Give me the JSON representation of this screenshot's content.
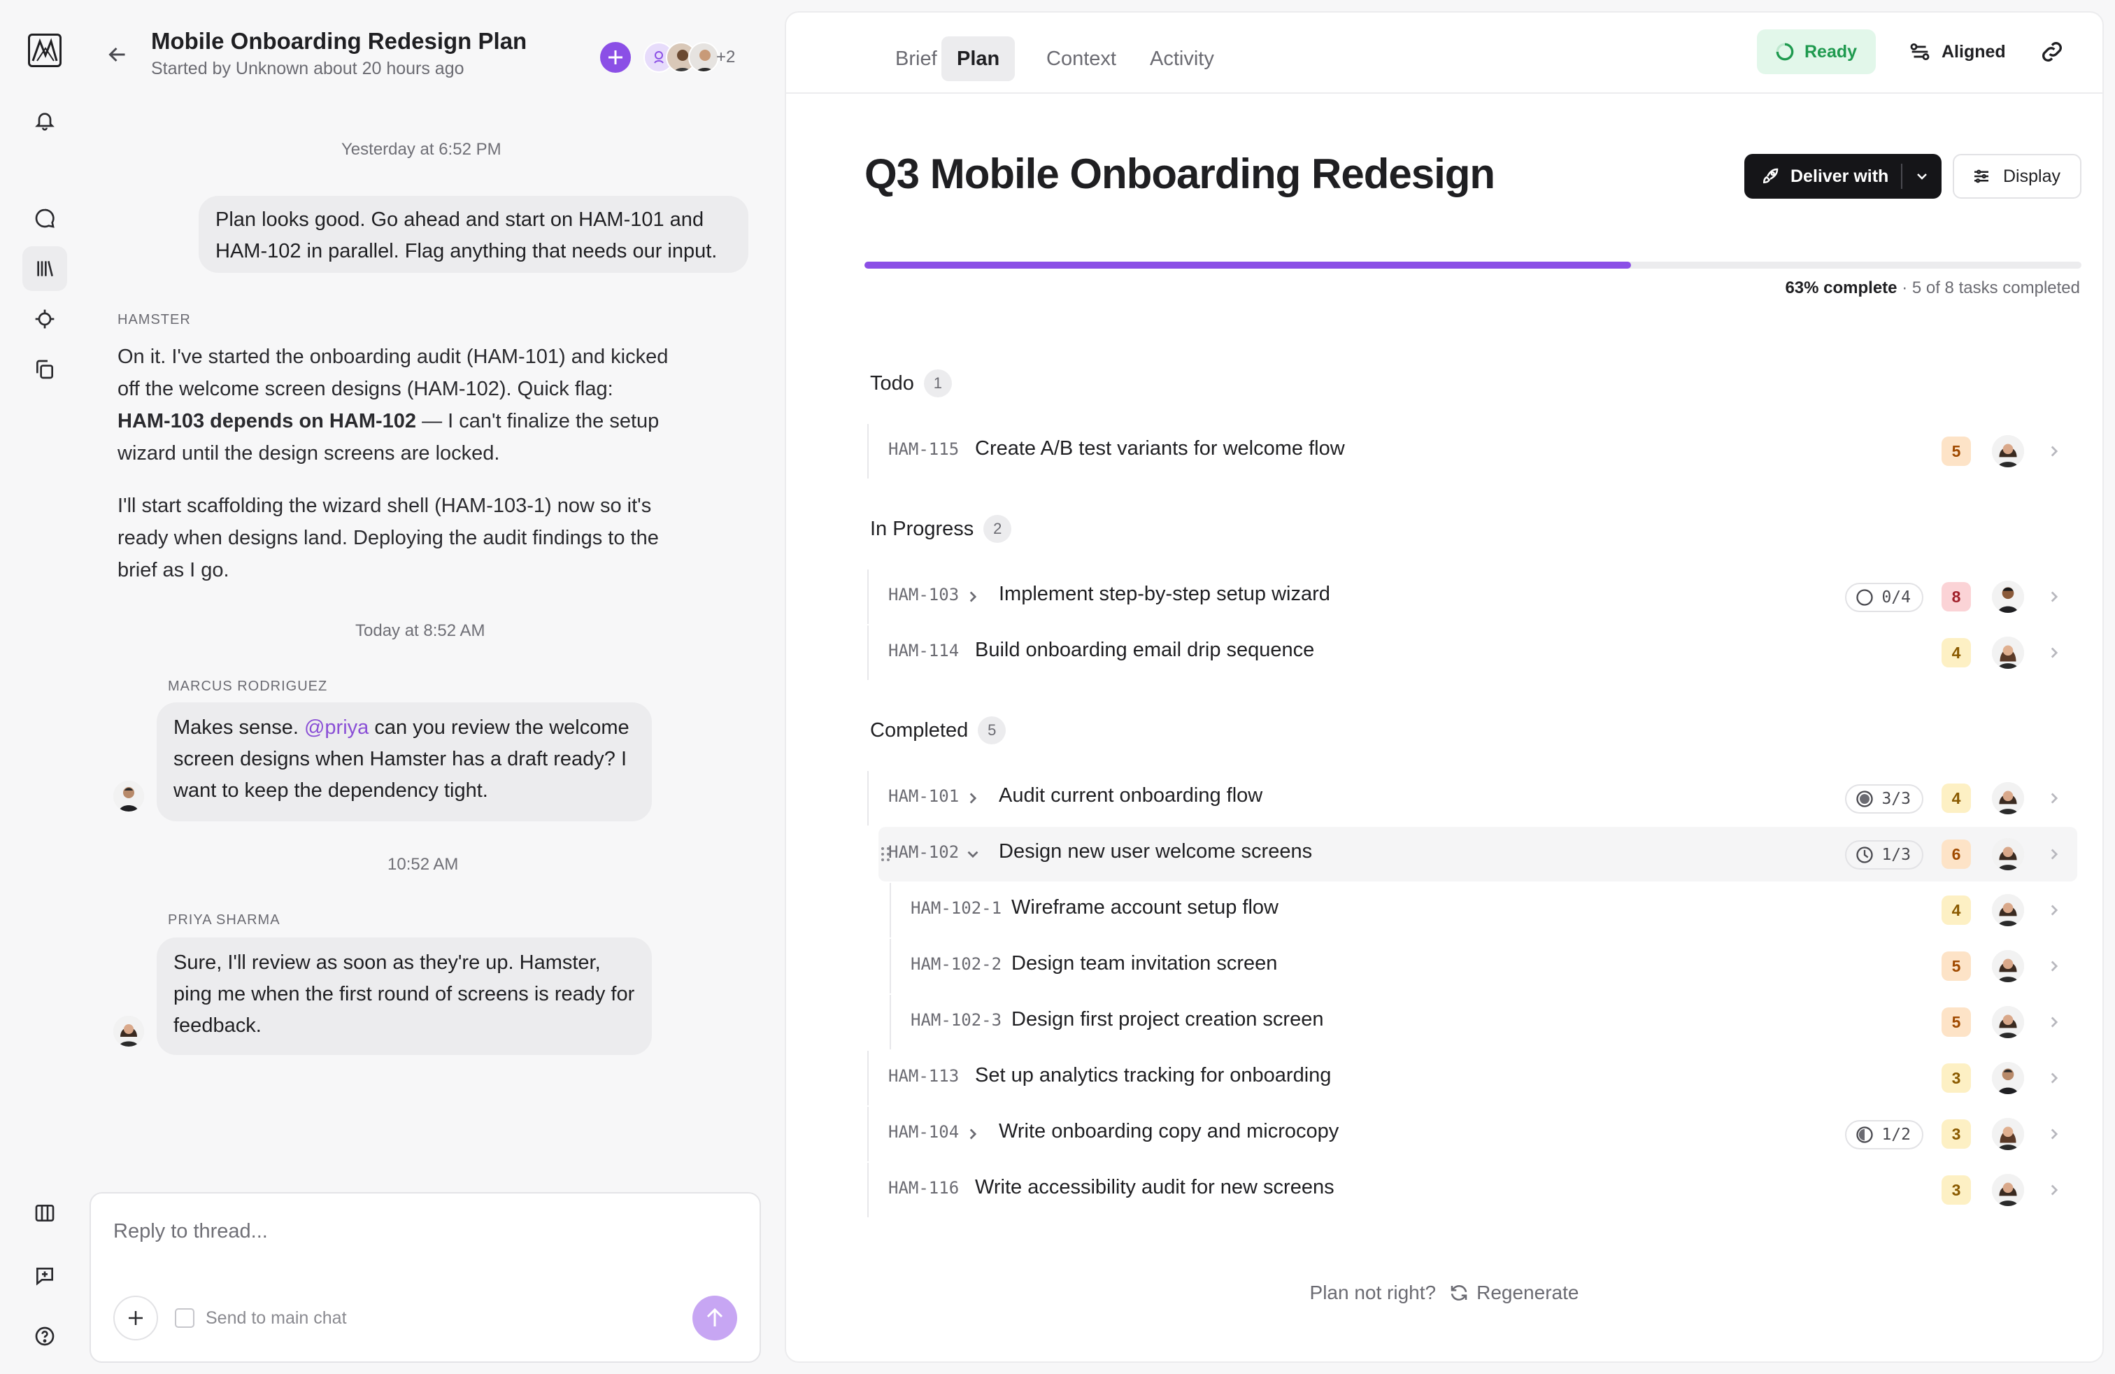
{
  "rail": {
    "logo": "app-logo",
    "icons": [
      "bell-icon",
      "chat-icon",
      "library-icon",
      "target-icon",
      "copy-icon",
      "columns-icon",
      "feedback-icon",
      "help-icon"
    ]
  },
  "thread": {
    "title": "Mobile Onboarding Redesign Plan",
    "subtitle": "Started by Unknown about 20 hours ago",
    "participants_more": "+2",
    "messages": {
      "ts1": "Yesterday at 6:52 PM",
      "user1": "Plan looks good. Go ahead and start on HAM-101 and HAM-102 in parallel. Flag anything that needs our input.",
      "hamster_author": "HAMSTER",
      "hamster_p1_a": "On it. I've started the onboarding audit (HAM-101) and kicked off the welcome screen designs (HAM-102). Quick flag: ",
      "hamster_p1_bold": "HAM-103 depends on HAM-102",
      "hamster_p1_b": " — I can't finalize the setup wizard until the design screens are locked.",
      "hamster_p2": "I'll start scaffolding the wizard shell (HAM-103-1) now so it's ready when designs land. Deploying the audit findings to the brief as I go.",
      "ts2": "Today at 8:52 AM",
      "marcus_author": "MARCUS RODRIGUEZ",
      "marcus_a": "Makes sense. ",
      "marcus_mention": "@priya",
      "marcus_b": " can you review the welcome screen designs when Hamster has a draft ready? I want to keep the dependency tight.",
      "ts3": "10:52 AM",
      "priya_author": "PRIYA SHARMA",
      "priya": "Sure, I'll review as soon as they're up. Hamster, ping me when the first round of screens is ready for feedback."
    },
    "composer": {
      "placeholder": "Reply to thread...",
      "send_to_main": "Send to main chat"
    }
  },
  "panel": {
    "tabs": [
      "Brief",
      "Plan",
      "Context",
      "Activity"
    ],
    "selected_tab": "Plan",
    "status": "Ready",
    "aligned": "Aligned",
    "title": "Q3 Mobile Onboarding Redesign",
    "deliver_label": "Deliver with",
    "display_label": "Display",
    "progress": {
      "fraction": 0.63,
      "label_bold": "63% complete",
      "label_rest": " · 5 of 8 tasks completed"
    },
    "sections": [
      {
        "name": "Todo",
        "count": "1"
      },
      {
        "name": "In Progress",
        "count": "2"
      },
      {
        "name": "Completed",
        "count": "5"
      }
    ],
    "tasks": [
      {
        "id": "HAM-115",
        "name": "Create A/B test variants for welcome flow",
        "points": "5"
      },
      {
        "id": "HAM-103",
        "name": "Implement step-by-step setup wizard",
        "progress": "0/4",
        "points": "8"
      },
      {
        "id": "HAM-114",
        "name": "Build onboarding email drip sequence",
        "points": "4"
      },
      {
        "id": "HAM-101",
        "name": "Audit current onboarding flow",
        "progress": "3/3",
        "points": "4"
      },
      {
        "id": "HAM-102",
        "name": "Design new user welcome screens",
        "progress": "1/3",
        "points": "6"
      },
      {
        "id": "HAM-102-1",
        "name": "Wireframe account setup flow",
        "points": "4"
      },
      {
        "id": "HAM-102-2",
        "name": "Design team invitation screen",
        "points": "5"
      },
      {
        "id": "HAM-102-3",
        "name": "Design first project creation screen",
        "points": "5"
      },
      {
        "id": "HAM-113",
        "name": "Set up analytics tracking for onboarding",
        "points": "3"
      },
      {
        "id": "HAM-104",
        "name": "Write onboarding copy and microcopy",
        "progress": "1/2",
        "points": "3"
      },
      {
        "id": "HAM-116",
        "name": "Write accessibility audit for new screens",
        "points": "3"
      }
    ],
    "footer": {
      "question": "Plan not right?",
      "regenerate": "Regenerate"
    },
    "colors": {
      "accent": "#8b4fe6",
      "ready_bg": "#e2f7ea",
      "ready_fg": "#1f9a4f"
    }
  }
}
